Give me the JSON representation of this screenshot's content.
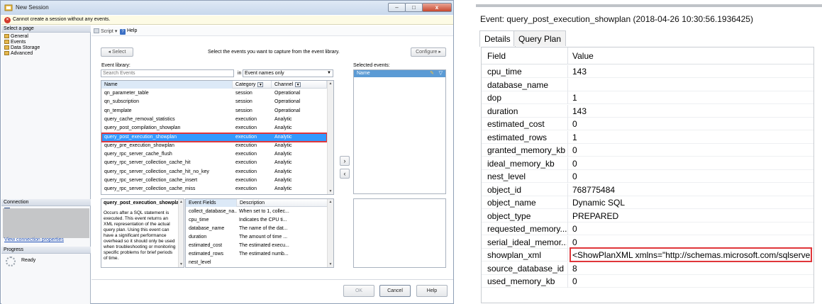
{
  "dialog": {
    "title": "New Session",
    "error_message": "Cannot create a session without any events.",
    "window_buttons": {
      "minimize": "–",
      "maximize": "□",
      "close": "x"
    },
    "left_pane": {
      "select_page_header": "Select a page",
      "pages": [
        "General",
        "Events",
        "Data Storage",
        "Advanced"
      ],
      "connection_header": "Connection",
      "connection_link": "View connection properties",
      "progress_header": "Progress",
      "progress_status": "Ready"
    },
    "toolbar": {
      "script_label": "Script",
      "help_label": "Help"
    },
    "select_button": "Select",
    "instruction": "Select the events you want to capture from the event library.",
    "configure_button": "Configure",
    "event_library_label": "Event library:",
    "search_placeholder": "Search Events",
    "in_label": "in",
    "search_scope": "Event names only",
    "selected_events_label": "Selected events:",
    "selected_events_column": "Name",
    "grid_columns": {
      "name": "Name",
      "category": "Category",
      "channel": "Channel"
    },
    "events": [
      {
        "name": "qn_parameter_table",
        "category": "session",
        "channel": "Operational"
      },
      {
        "name": "qn_subscription",
        "category": "session",
        "channel": "Operational"
      },
      {
        "name": "qn_template",
        "category": "session",
        "channel": "Operational"
      },
      {
        "name": "query_cache_removal_statistics",
        "category": "execution",
        "channel": "Analytic"
      },
      {
        "name": "query_post_compilation_showplan",
        "category": "execution",
        "channel": "Analytic"
      },
      {
        "name": "query_post_execution_showplan",
        "category": "execution",
        "channel": "Analytic"
      },
      {
        "name": "query_pre_execution_showplan",
        "category": "execution",
        "channel": "Analytic"
      },
      {
        "name": "query_rpc_server_cache_flush",
        "category": "execution",
        "channel": "Analytic"
      },
      {
        "name": "query_rpc_server_collection_cache_hit",
        "category": "execution",
        "channel": "Analytic"
      },
      {
        "name": "query_rpc_server_collection_cache_hit_no_key",
        "category": "execution",
        "channel": "Analytic"
      },
      {
        "name": "query_rpc_server_collection_cache_insert",
        "category": "execution",
        "channel": "Analytic"
      },
      {
        "name": "query_rpc_server_collection_cache_miss",
        "category": "execution",
        "channel": "Analytic"
      }
    ],
    "selected_event_index": 5,
    "description": {
      "title": "query_post_execution_showplan",
      "text": "Occurs after a SQL statement is executed. This event returns an XML representation of the actual query plan. Using this event can have a significant performance overhead so it should only be used when troubleshooting or monitoring specific problems for brief periods of time."
    },
    "fields_columns": {
      "field": "Event Fields",
      "description": "Description"
    },
    "fields": [
      {
        "name": "collect_database_na...",
        "desc": "When set to 1, collec..."
      },
      {
        "name": "cpu_time",
        "desc": "Indicates the CPU ti..."
      },
      {
        "name": "database_name",
        "desc": "The name of the dat..."
      },
      {
        "name": "duration",
        "desc": "The amount of time ..."
      },
      {
        "name": "estimated_cost",
        "desc": "The estimated execu..."
      },
      {
        "name": "estimated_rows",
        "desc": "The estimated numb..."
      },
      {
        "name": "nest_level",
        "desc": ""
      }
    ],
    "buttons": {
      "ok": "OK",
      "cancel": "Cancel",
      "help": "Help"
    }
  },
  "event_panel": {
    "title": "Event: query_post_execution_showplan (2018-04-26 10:30:56.1936425)",
    "tabs": [
      "Details",
      "Query Plan"
    ],
    "columns": {
      "field": "Field",
      "value": "Value"
    },
    "rows": [
      {
        "field": "cpu_time",
        "value": "143"
      },
      {
        "field": "database_name",
        "value": ""
      },
      {
        "field": "dop",
        "value": "1"
      },
      {
        "field": "duration",
        "value": "143"
      },
      {
        "field": "estimated_cost",
        "value": "0"
      },
      {
        "field": "estimated_rows",
        "value": "1"
      },
      {
        "field": "granted_memory_kb",
        "value": "0"
      },
      {
        "field": "ideal_memory_kb",
        "value": "0"
      },
      {
        "field": "nest_level",
        "value": "0"
      },
      {
        "field": "object_id",
        "value": "768775484"
      },
      {
        "field": "object_name",
        "value": "Dynamic SQL"
      },
      {
        "field": "object_type",
        "value": "PREPARED"
      },
      {
        "field": "requested_memory...",
        "value": "0"
      },
      {
        "field": "serial_ideal_memor...",
        "value": "0"
      },
      {
        "field": "showplan_xml",
        "value": "<ShowPlanXML xmlns=\"http://schemas.microsoft.com/sqlserver..."
      },
      {
        "field": "source_database_id",
        "value": "8"
      },
      {
        "field": "used_memory_kb",
        "value": "0"
      }
    ],
    "highlighted_row_index": 14
  },
  "colors": {
    "selection": "#3399ff",
    "highlight_border": "#e0363a",
    "error": "#d33a2c"
  }
}
